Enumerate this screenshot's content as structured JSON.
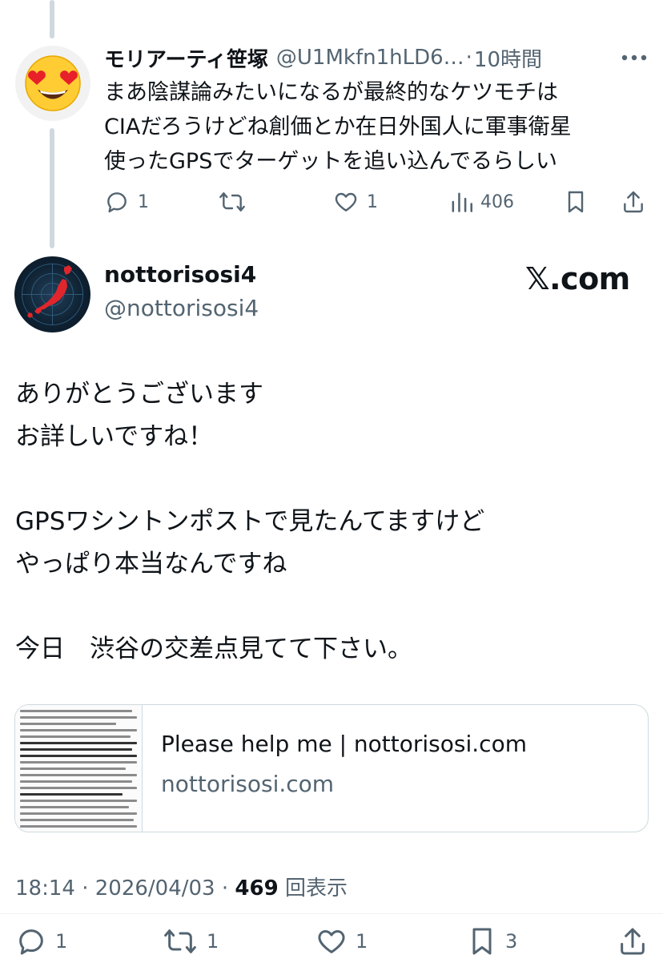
{
  "reply": {
    "display_name": "モリアーティ笹塚",
    "handle": "@U1Mkfn1hLD6…",
    "separator": "·",
    "time": "10時間",
    "text": "まあ陰謀論みたいになるが最終的なケツモチは\nCIAだろうけどね創価とか在日外国人に軍事衛星\n使ったGPSでターゲットを追い込んでるらしい",
    "reply_count": "1",
    "retweet_count": "",
    "like_count": "1",
    "view_count": "406"
  },
  "main": {
    "display_name": "nottorisosi4",
    "handle": "@nottorisosi4",
    "watermark": "𝕏.com",
    "text": "ありがとうございます\nお詳しいですね！\n\nGPSワシントンポストで見たんてますけど\nやっぱり本当なんですね\n\n今日　渋谷の交差点見てて下さい。",
    "card": {
      "title": "Please help me | nottorisosi.com",
      "domain": "nottorisosi.com"
    },
    "time": "18:14",
    "date": "2026/04/03",
    "views": "469",
    "views_label": "回表示",
    "reply_count": "1",
    "retweet_count": "1",
    "like_count": "1",
    "bookmark_count": "3"
  },
  "colors": {
    "text": "#0f1419",
    "muted": "#536471",
    "border": "#cfd9de"
  }
}
